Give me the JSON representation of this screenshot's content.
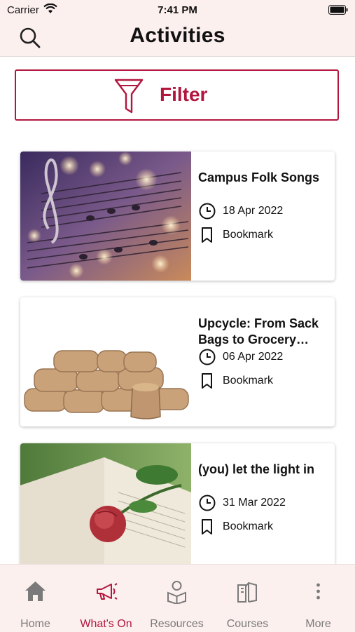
{
  "status_bar": {
    "carrier": "Carrier",
    "time": "7:41 PM"
  },
  "header": {
    "title": "Activities"
  },
  "filter": {
    "label": "Filter"
  },
  "activities": [
    {
      "title": "Campus Folk Songs",
      "date": "18 Apr 2022",
      "bookmark": "Bookmark"
    },
    {
      "title": "Upcycle: From Sack Bags to Grocery Bags",
      "date": "06 Apr 2022",
      "bookmark": "Bookmark"
    },
    {
      "title": "(you) let the light in",
      "date": "31 Mar 2022",
      "bookmark": "Bookmark"
    }
  ],
  "tabs": [
    {
      "label": "Home",
      "icon": "home-icon"
    },
    {
      "label": "What's On",
      "icon": "megaphone-icon",
      "active": true
    },
    {
      "label": "Resources",
      "icon": "reader-icon"
    },
    {
      "label": "Courses",
      "icon": "books-icon"
    },
    {
      "label": "More",
      "icon": "more-icon"
    }
  ],
  "colors": {
    "accent": "#b2163d",
    "header_bg": "#fcf0ef",
    "inactive": "#7a7a7a"
  }
}
